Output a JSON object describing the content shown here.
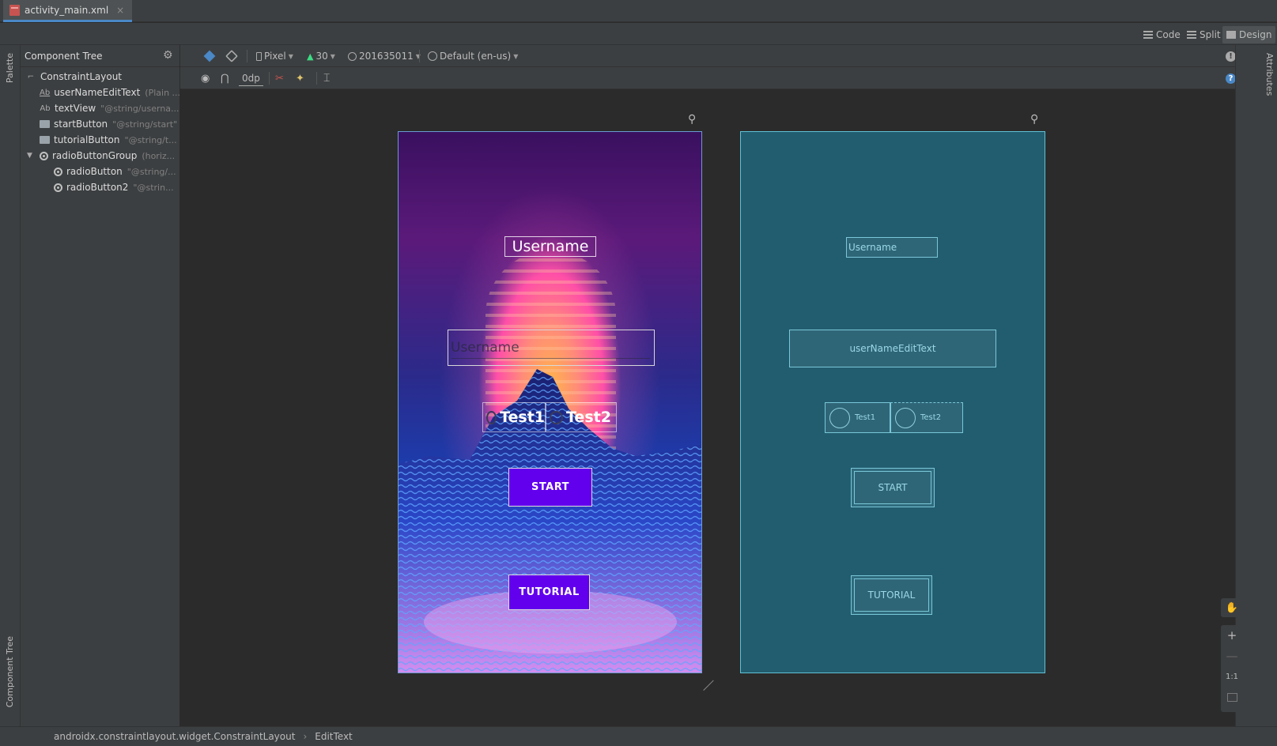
{
  "file_tab": {
    "label": "activity_main.xml",
    "close": "×"
  },
  "modes": {
    "code": "Code",
    "split": "Split",
    "design": "Design"
  },
  "palette_label": "Palette",
  "component_tree_label": "Component Tree",
  "attributes_label": "Attributes",
  "tree": {
    "title": "Component Tree",
    "items": [
      {
        "name": "ConstraintLayout",
        "desc": "",
        "icon": "constraint-layout-icon",
        "indent": 0
      },
      {
        "name": "userNameEditText",
        "desc": "(Plain ...",
        "icon": "text-field-icon",
        "indent": 1
      },
      {
        "name": "textView",
        "desc": "\"@string/userna...",
        "icon": "text-view-icon",
        "indent": 1
      },
      {
        "name": "startButton",
        "desc": "\"@string/start\"",
        "icon": "button-icon",
        "indent": 1
      },
      {
        "name": "tutorialButton",
        "desc": "\"@string/t...",
        "icon": "button-icon",
        "indent": 1
      },
      {
        "name": "radioButtonGroup",
        "desc": "(horiz...",
        "icon": "radio-group-icon",
        "indent": 1
      },
      {
        "name": "radioButton",
        "desc": "\"@string/...",
        "icon": "radio-button-icon",
        "indent": 2
      },
      {
        "name": "radioButton2",
        "desc": "\"@strin...",
        "icon": "radio-button-icon",
        "indent": 2
      }
    ]
  },
  "toolbar": {
    "device": "Pixel",
    "api": "30",
    "theme": "201635011",
    "locale": "Default (en-us)",
    "margin": "0dp"
  },
  "design": {
    "title_text": "Username",
    "edit_hint": "Username",
    "radio1": "Test1",
    "radio2": "Test2",
    "start": "START",
    "tutorial": "TUTORIAL"
  },
  "blueprint": {
    "title_text": "Username",
    "edit_label": "userNameEditText",
    "radio1": "Test1",
    "radio2": "Test2",
    "start": "START",
    "tutorial": "TUTORIAL"
  },
  "zoom": {
    "fit": "1:1",
    "plus": "+",
    "minus": "—"
  },
  "status": {
    "path1": "androidx.constraintlayout.widget.ConstraintLayout",
    "sep": "›",
    "path2": "EditText"
  },
  "colors": {
    "ide_bg": "#2b2b2b",
    "panel_bg": "#3c3f41",
    "blueprint_bg": "#225d6f",
    "button_purple": "#6200ee",
    "accent_blue": "#4a88c7"
  }
}
